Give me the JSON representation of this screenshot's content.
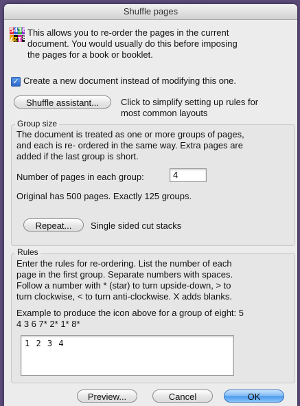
{
  "window": {
    "title": "Shuffle pages"
  },
  "app_icon": {
    "digits": [
      "5",
      "4",
      "3",
      "6",
      "7",
      "2",
      "1",
      "8"
    ]
  },
  "intro": {
    "line1": "This allows you to re-order the pages in the current",
    "line2": "document. You would usually do this before imposing",
    "line3": "the pages for a book or booklet."
  },
  "new_document_checkbox": {
    "label": "Create a new document instead of modifying this one.",
    "checked": true
  },
  "shuffle_assistant": {
    "button_label": "Shuffle assistant...",
    "hint_line1": "Click to simplify setting up rules for",
    "hint_line2": "most common layouts"
  },
  "group_size": {
    "title": "Group size",
    "desc_line1": "The document is treated as one or more groups of pages,",
    "desc_line2": "and each is re- ordered in the same way. Extra pages are",
    "desc_line3": "added if the last group is short.",
    "pages_label": "Number of pages in each group:",
    "pages_value": "4",
    "status": "Original has 500 pages. Exactly 125 groups.",
    "repeat_button": "Repeat...",
    "repeat_value": "Single sided cut stacks"
  },
  "rules": {
    "title": "Rules",
    "desc_line1": "Enter the rules for re-ordering. List the number of each",
    "desc_line2": "page in the first group. Separate numbers with spaces.",
    "desc_line3": "Follow a number with * (star)  to turn upside-down, > to",
    "desc_line4": "turn clockwise, < to turn anti-clockwise. X adds blanks.",
    "example_line1": "Example to produce the icon above for a group of eight: 5",
    "example_line2": "4 3 6 7* 2* 1* 8*",
    "value": "1 2 3 4"
  },
  "footer": {
    "preview_label": "Preview...",
    "cancel_label": "Cancel",
    "ok_label": "OK"
  },
  "colors": {
    "accent": "#3d77c2",
    "icon_colors": [
      "#e4232f",
      "#2b58d8",
      "#2ca53a",
      "#8a2bd0",
      "#e8a20a",
      "#1a1a1a",
      "#d02aa2",
      "#1a1a1a"
    ]
  }
}
